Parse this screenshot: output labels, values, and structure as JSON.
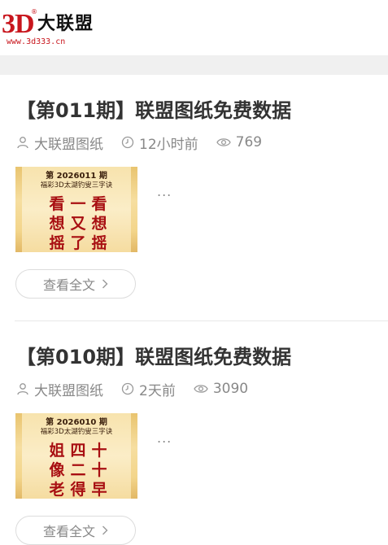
{
  "header": {
    "logo_3d": "3D",
    "logo_reg": "®",
    "logo_name": "大联盟",
    "logo_url": "www.3d333.cn"
  },
  "posts": [
    {
      "title": "【第011期】联盟图纸免费数据",
      "author": "大联盟图纸",
      "time": "12小时前",
      "views": "769",
      "thumb": {
        "issue": "第 2026011 期",
        "subtitle": "福彩3D太湖钓叟三字诀",
        "poem": [
          "看",
          "一",
          "看",
          "想",
          "又",
          "想",
          "摇",
          "了",
          "摇"
        ]
      },
      "excerpt": "...",
      "read_more": "查看全文"
    },
    {
      "title": "【第010期】联盟图纸免费数据",
      "author": "大联盟图纸",
      "time": "2天前",
      "views": "3090",
      "thumb": {
        "issue": "第 2026010 期",
        "subtitle": "福彩3D太湖钓叟三字诀",
        "poem": [
          "姐",
          "四",
          "十",
          "像",
          "二",
          "十",
          "老",
          "得",
          "早"
        ]
      },
      "excerpt": "...",
      "read_more": "查看全文"
    }
  ],
  "colors": {
    "brand_red": "#c8161d",
    "poem_red": "#a80f12",
    "meta_gray": "#888888"
  },
  "icons": {
    "author": "user-icon",
    "time": "clock-icon",
    "views": "eye-icon",
    "read_more": "chevron-right-icon"
  }
}
